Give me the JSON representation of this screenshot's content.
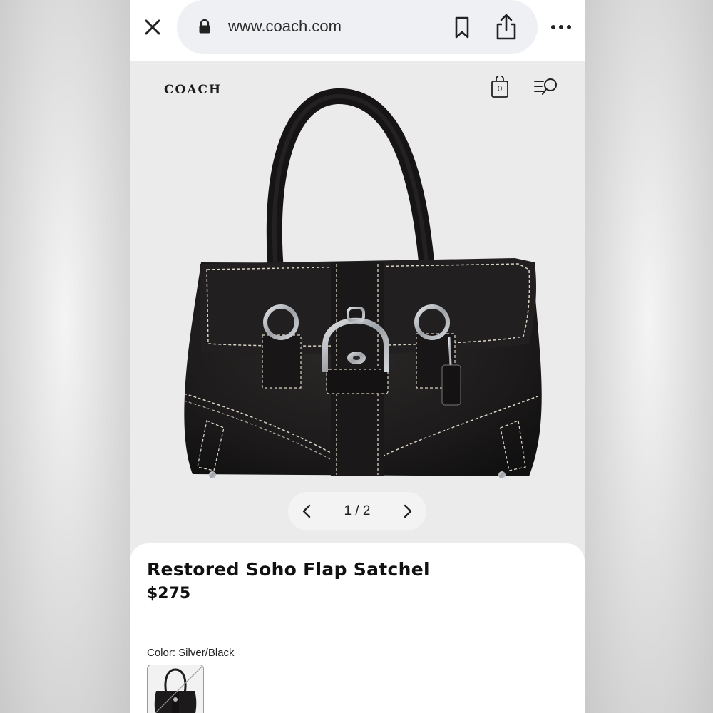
{
  "browser": {
    "url": "www.coach.com"
  },
  "header": {
    "brand": "COACH",
    "bag_count": "0"
  },
  "gallery": {
    "pager": "1 / 2"
  },
  "product": {
    "title": "Restored Soho Flap Satchel",
    "price": "$275",
    "color_label": "Color: Silver/Black"
  },
  "colors": {
    "bag_leather": "#1c1a1a",
    "stitch": "#d9d3c4",
    "hardware": "#b9bcc0",
    "page_bg": "#ebebeb"
  }
}
